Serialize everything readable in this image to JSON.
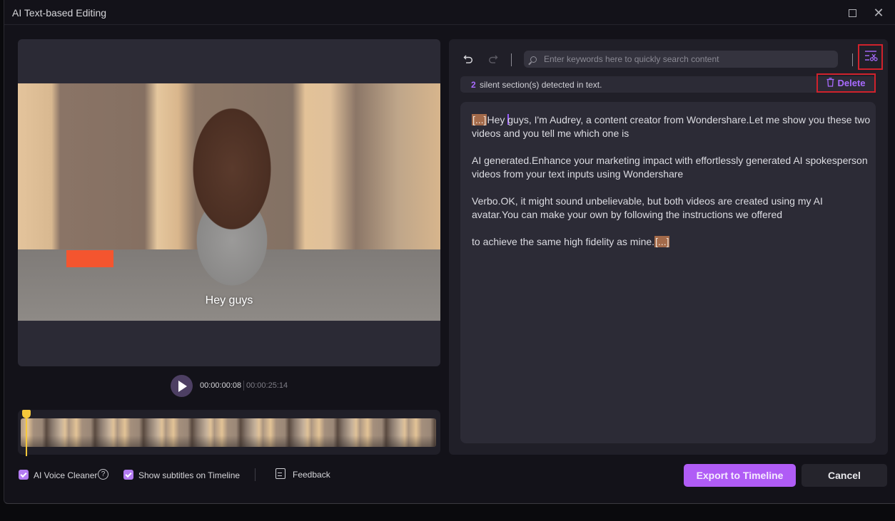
{
  "window": {
    "title": "AI Text-based Editing",
    "maximize_icon": "maximize-icon",
    "close_icon": "✕"
  },
  "video": {
    "subtitle": "Hey guys",
    "current_time": "00:00:00:08",
    "total_time": "00:00:25:14",
    "play_icon": "play-icon"
  },
  "toolbar": {
    "undo_icon": "⮌",
    "redo_icon": "⮎",
    "search_placeholder": "Enter keywords here to quickly search content",
    "search_value": ""
  },
  "silence": {
    "count": "2",
    "message": "silent section(s) detected in text.",
    "delete_label": "Delete"
  },
  "transcript": {
    "silence_marker": "[...]",
    "paragraphs": [
      {
        "before_cursor": "Hey ",
        "after_cursor": "guys, I'm Audrey, a content creator from Wondershare.Let me show you these two videos and you tell me which one is"
      },
      {
        "text": " AI generated.Enhance your marketing impact with effortlessly generated AI spokesperson videos from your text inputs using Wondershare"
      },
      {
        "text": " Verbo.OK, it might sound unbelievable, but both videos are created using my AI avatar.You can make your own by following the instructions we offered"
      },
      {
        "text": " to achieve the same high fidelity as mine."
      }
    ]
  },
  "footer": {
    "voice_cleaner_label": "AI Voice Cleaner",
    "voice_cleaner_checked": true,
    "subtitles_label": "Show subtitles on Timeline",
    "subtitles_checked": true,
    "help_icon": "?",
    "feedback_label": "Feedback",
    "export_label": "Export to Timeline",
    "cancel_label": "Cancel"
  },
  "colors": {
    "accent": "#b05cf6",
    "accent_text": "#a86bff",
    "highlight_border": "#d0222c",
    "silence_marker_bg": "#a36a4a",
    "playhead": "#f6c83b"
  }
}
